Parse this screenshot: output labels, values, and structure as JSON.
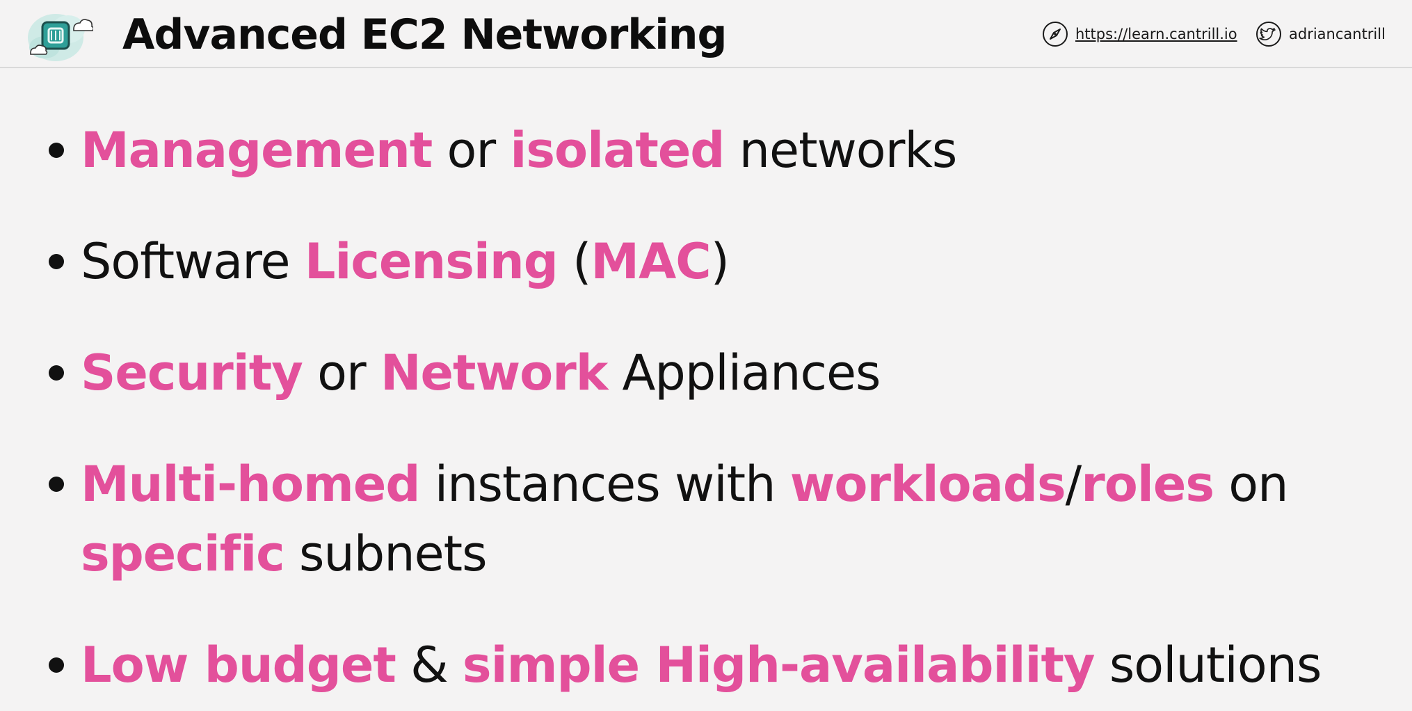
{
  "header": {
    "title": "Advanced EC2 Networking",
    "website_label": "https://learn.cantrill.io",
    "twitter_handle": "adriancantrill"
  },
  "bullets": [
    {
      "lines": [
        [
          {
            "text": "Management",
            "highlight": true
          },
          {
            "text": " or ",
            "highlight": false
          },
          {
            "text": "isolated",
            "highlight": true
          },
          {
            "text": " networks",
            "highlight": false
          }
        ]
      ]
    },
    {
      "lines": [
        [
          {
            "text": "Software ",
            "highlight": false
          },
          {
            "text": "Licensing",
            "highlight": true
          },
          {
            "text": " (",
            "highlight": false
          },
          {
            "text": "MAC",
            "highlight": true
          },
          {
            "text": ")",
            "highlight": false
          }
        ]
      ]
    },
    {
      "lines": [
        [
          {
            "text": "Security",
            "highlight": true
          },
          {
            "text": " or ",
            "highlight": false
          },
          {
            "text": "Network",
            "highlight": true
          },
          {
            "text": " Appliances",
            "highlight": false
          }
        ]
      ]
    },
    {
      "lines": [
        [
          {
            "text": "Multi-homed",
            "highlight": true
          },
          {
            "text": " instances with ",
            "highlight": false
          },
          {
            "text": "workloads",
            "highlight": true
          },
          {
            "text": "/",
            "highlight": false
          },
          {
            "text": "roles",
            "highlight": true
          },
          {
            "text": " on",
            "highlight": false
          }
        ],
        [
          {
            "text": "specific",
            "highlight": true
          },
          {
            "text": " subnets",
            "highlight": false
          }
        ]
      ]
    },
    {
      "lines": [
        [
          {
            "text": "Low budget",
            "highlight": true
          },
          {
            "text": " & ",
            "highlight": false
          },
          {
            "text": "simple High-availability",
            "highlight": true
          },
          {
            "text": " solutions",
            "highlight": false
          }
        ]
      ]
    }
  ],
  "colors": {
    "accent": "#e3509b",
    "text": "#111111",
    "background": "#f4f3f3",
    "logo_teal": "#2f9f98"
  },
  "icons": {
    "logo": "cloud-server-logo-icon",
    "website": "compass-icon",
    "twitter": "twitter-bird-icon"
  }
}
